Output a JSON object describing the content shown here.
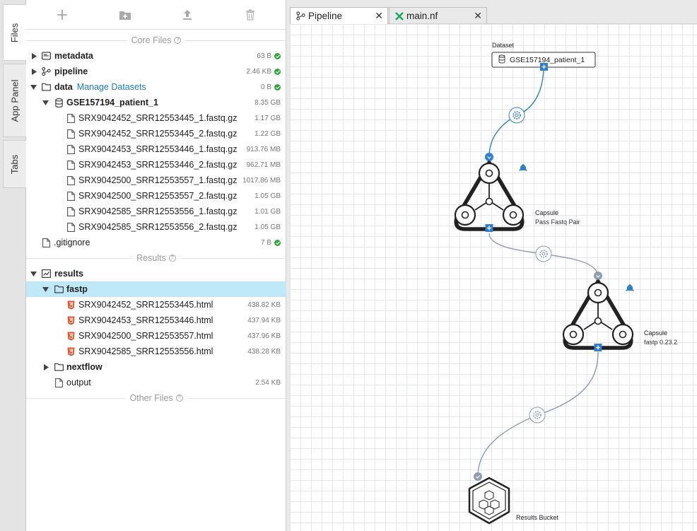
{
  "vertical_tabs": [
    {
      "label": "Files",
      "active": true
    },
    {
      "label": "App Panel",
      "active": false
    },
    {
      "label": "Tabs",
      "active": false
    }
  ],
  "sections": {
    "core": "Core Files",
    "results": "Results",
    "other": "Other Files"
  },
  "tree": {
    "metadata": {
      "name": "metadata",
      "size": "63 B"
    },
    "pipeline": {
      "name": "pipeline",
      "size": "2.46 KB"
    },
    "data": {
      "name": "data",
      "link": "Manage Datasets",
      "size": "0 B"
    },
    "dataset": {
      "name": "GSE157194_patient_1",
      "size": "8.35 GB"
    },
    "fastq": [
      {
        "name": "SRX9042452_SRR12553445_1.fastq.gz",
        "size": "1.17 GB"
      },
      {
        "name": "SRX9042452_SRR12553445_2.fastq.gz",
        "size": "1.22 GB"
      },
      {
        "name": "SRX9042453_SRR12553446_1.fastq.gz",
        "size": "913.76 MB"
      },
      {
        "name": "SRX9042453_SRR12553446_2.fastq.gz",
        "size": "962.71 MB"
      },
      {
        "name": "SRX9042500_SRR12553557_1.fastq.gz",
        "size": "1017.86 MB"
      },
      {
        "name": "SRX9042500_SRR12553557_2.fastq.gz",
        "size": "1.05 GB"
      },
      {
        "name": "SRX9042585_SRR12553556_1.fastq.gz",
        "size": "1.01 GB"
      },
      {
        "name": "SRX9042585_SRR12553556_2.fastq.gz",
        "size": "1.05 GB"
      }
    ],
    "gitignore": {
      "name": ".gitignore",
      "size": "7 B"
    },
    "results": {
      "name": "results"
    },
    "fastp": {
      "name": "fastp"
    },
    "html_files": [
      {
        "name": "SRX9042452_SRR12553445.html",
        "size": "438.82 KB"
      },
      {
        "name": "SRX9042453_SRR12553446.html",
        "size": "437.94 KB"
      },
      {
        "name": "SRX9042500_SRR12553557.html",
        "size": "437.96 KB"
      },
      {
        "name": "SRX9042585_SRR12553556.html",
        "size": "438.28 KB"
      }
    ],
    "nextflow": {
      "name": "nextflow"
    },
    "output": {
      "name": "output",
      "size": "2.54 KB"
    }
  },
  "editor_tabs": [
    {
      "label": "Pipeline",
      "active": true,
      "close": "✕"
    },
    {
      "label": "main.nf",
      "active": false,
      "close": "✕"
    }
  ],
  "pipeline": {
    "dataset_label": "Dataset",
    "dataset_name": "GSE157194_patient_1",
    "capsule1_type": "Capsule",
    "capsule1_name": "Pass Fastq Pair",
    "capsule2_type": "Capsule",
    "capsule2_name": "fastp 0.23.2",
    "results_bucket": "Results Bucket"
  },
  "colors": {
    "accent": "#1a7bc1",
    "ok": "#2fa53c",
    "selected_row": "#bfe9f8",
    "html_icon": "#e8542c",
    "connector_blue": "#2f7fd0",
    "connector_gray": "#8d9db3"
  }
}
